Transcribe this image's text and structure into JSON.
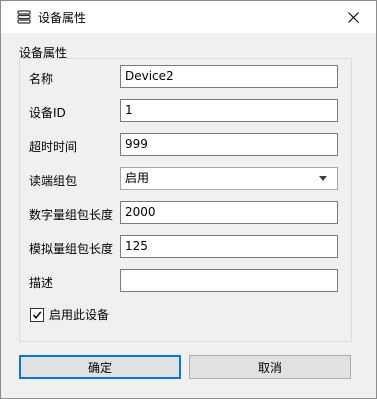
{
  "window": {
    "title": "设备属性",
    "icon": "device-list-icon",
    "close_icon": "close-icon"
  },
  "group": {
    "title": "设备属性"
  },
  "fields": {
    "name": {
      "label": "名称",
      "value": "Device2"
    },
    "device_id": {
      "label": "设备ID",
      "value": "1"
    },
    "timeout": {
      "label": "超时时间",
      "value": "999"
    },
    "read_packing": {
      "label": "读端组包",
      "value": "启用"
    },
    "digital_packing_length": {
      "label": "数字量组包长度",
      "value": "2000"
    },
    "analog_packing_length": {
      "label": "模拟量组包长度",
      "value": "125"
    },
    "description": {
      "label": "描述",
      "value": ""
    }
  },
  "enable_device": {
    "label": "启用此设备",
    "checked": true
  },
  "buttons": {
    "ok": "确定",
    "cancel": "取消"
  },
  "colors": {
    "focus_border": "#0078d7",
    "dialog_bg": "#f0f0f0"
  }
}
